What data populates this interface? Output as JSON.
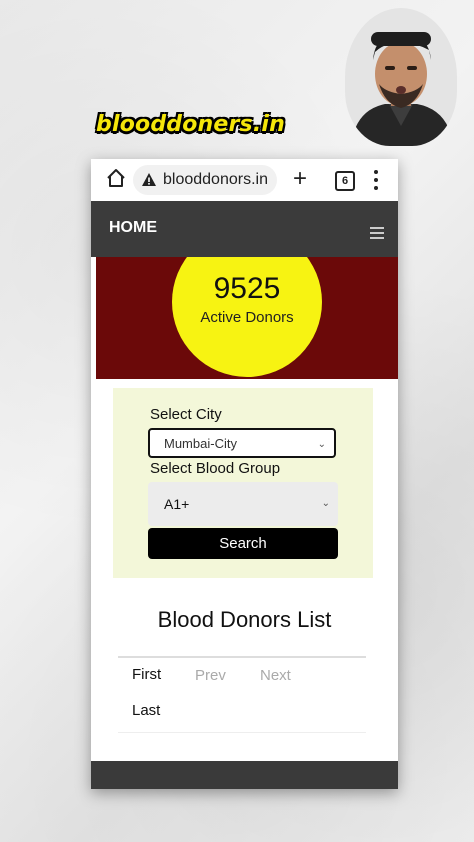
{
  "caption": "blooddoners.in",
  "browser": {
    "url": "blooddonors.in",
    "tab_count": "6",
    "new_tab_symbol": "+"
  },
  "nav": {
    "home_label": "HOME"
  },
  "hero": {
    "count": "9525",
    "label": "Active Donors"
  },
  "form": {
    "city_label": "Select City",
    "city_value": "Mumbai-City",
    "blood_label": "Select Blood Group",
    "blood_value": "A1+",
    "search_label": "Search"
  },
  "list": {
    "title": "Blood Donors List",
    "first": "First",
    "prev": "Prev",
    "next": "Next",
    "last": "Last"
  },
  "colors": {
    "hero_bg": "#6b0909",
    "circle": "#f7f312",
    "form_bg": "#f3f7d9",
    "nav_bg": "#3b3b3b"
  }
}
